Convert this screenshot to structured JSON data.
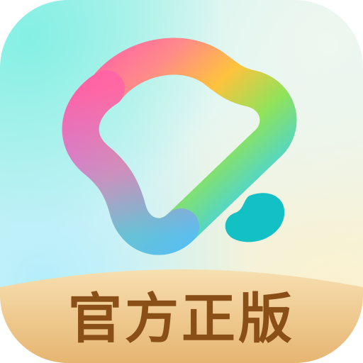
{
  "app_icon": {
    "badge_text": "官方正版",
    "colors": {
      "text": "#8a4e17",
      "banner_top": "#f7dfb0",
      "banner_bottom": "#e6b571",
      "bean": "#13c0c4"
    }
  }
}
